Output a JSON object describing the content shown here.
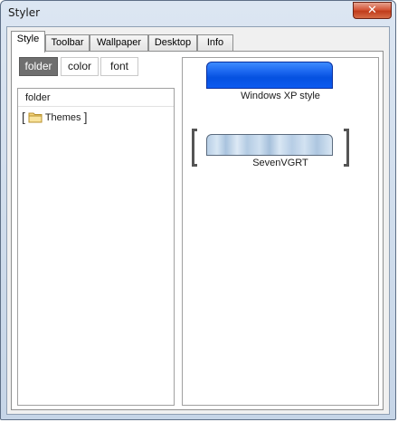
{
  "window": {
    "title": "Styler",
    "close_label": "✕"
  },
  "tabs": [
    {
      "label": "Style"
    },
    {
      "label": "Toolbar"
    },
    {
      "label": "Wallpaper"
    },
    {
      "label": "Desktop"
    },
    {
      "label": "Info"
    }
  ],
  "subtabs": [
    {
      "label": "folder"
    },
    {
      "label": "color"
    },
    {
      "label": "font"
    }
  ],
  "tree": {
    "header": "folder",
    "items": [
      {
        "label": "Themes"
      }
    ]
  },
  "styles": [
    {
      "label": "Windows XP style"
    },
    {
      "label": "SevenVGRT"
    }
  ],
  "colors": {
    "xp_blue": "#0551e0",
    "seven_glass": "#b8cfe6",
    "active_subtab": "#6f6f6f",
    "close_red": "#c03c1b"
  }
}
